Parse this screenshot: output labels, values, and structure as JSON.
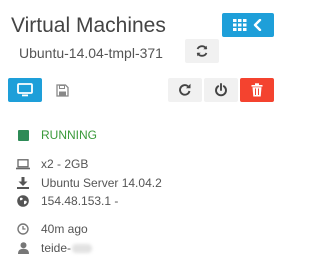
{
  "header": {
    "title": "Virtual Machines",
    "vm_name": "Ubuntu-14.04-tmpl-371"
  },
  "toolbar": {
    "grid_back_icon": "grid-back-icon",
    "refresh_icon": "refresh-icon",
    "vnc_icon": "monitor-icon",
    "save_icon": "floppy-disk-icon",
    "reboot_icon": "reboot-icon",
    "power_icon": "power-icon",
    "delete_icon": "trash-icon"
  },
  "details": {
    "status": "RUNNING",
    "resources": "x2 - 2GB",
    "image": "Ubuntu Server 14.04.2",
    "ip": "154.48.153.1 -",
    "age": "40m ago",
    "owner": "teide-"
  },
  "colors": {
    "accent": "#1e9fd9",
    "danger": "#f4432f",
    "running": "#2e8b57"
  }
}
